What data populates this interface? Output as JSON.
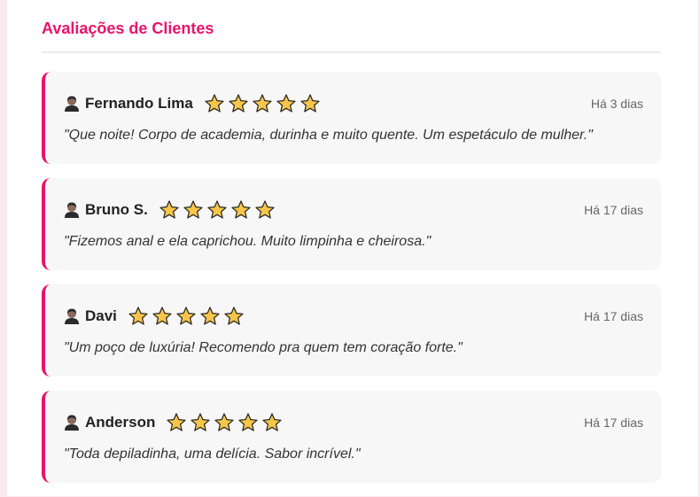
{
  "section": {
    "title": "Avaliações de Clientes"
  },
  "colors": {
    "accent": "#e8146b",
    "star_fill": "#f7c54a",
    "star_stroke": "#222222",
    "card_bg": "#f7f7f7"
  },
  "reviews": [
    {
      "name": "Fernando Lima",
      "rating": 5,
      "date": "Há 3 dias",
      "text": "\"Que noite! Corpo de academia, durinha e muito quente. Um espetáculo de mulher.\"",
      "avatar_icon": "person-icon",
      "star_icon": "star-icon"
    },
    {
      "name": "Bruno S.",
      "rating": 5,
      "date": "Há 17 dias",
      "text": "\"Fizemos anal e ela caprichou. Muito limpinha e cheirosa.\"",
      "avatar_icon": "person-icon",
      "star_icon": "star-icon"
    },
    {
      "name": "Davi",
      "rating": 5,
      "date": "Há 17 dias",
      "text": "\"Um poço de luxúria! Recomendo pra quem tem coração forte.\"",
      "avatar_icon": "person-icon",
      "star_icon": "star-icon"
    },
    {
      "name": "Anderson",
      "rating": 5,
      "date": "Há 17 dias",
      "text": "\"Toda depiladinha, uma delícia. Sabor incrível.\"",
      "avatar_icon": "person-icon",
      "star_icon": "star-icon"
    }
  ]
}
